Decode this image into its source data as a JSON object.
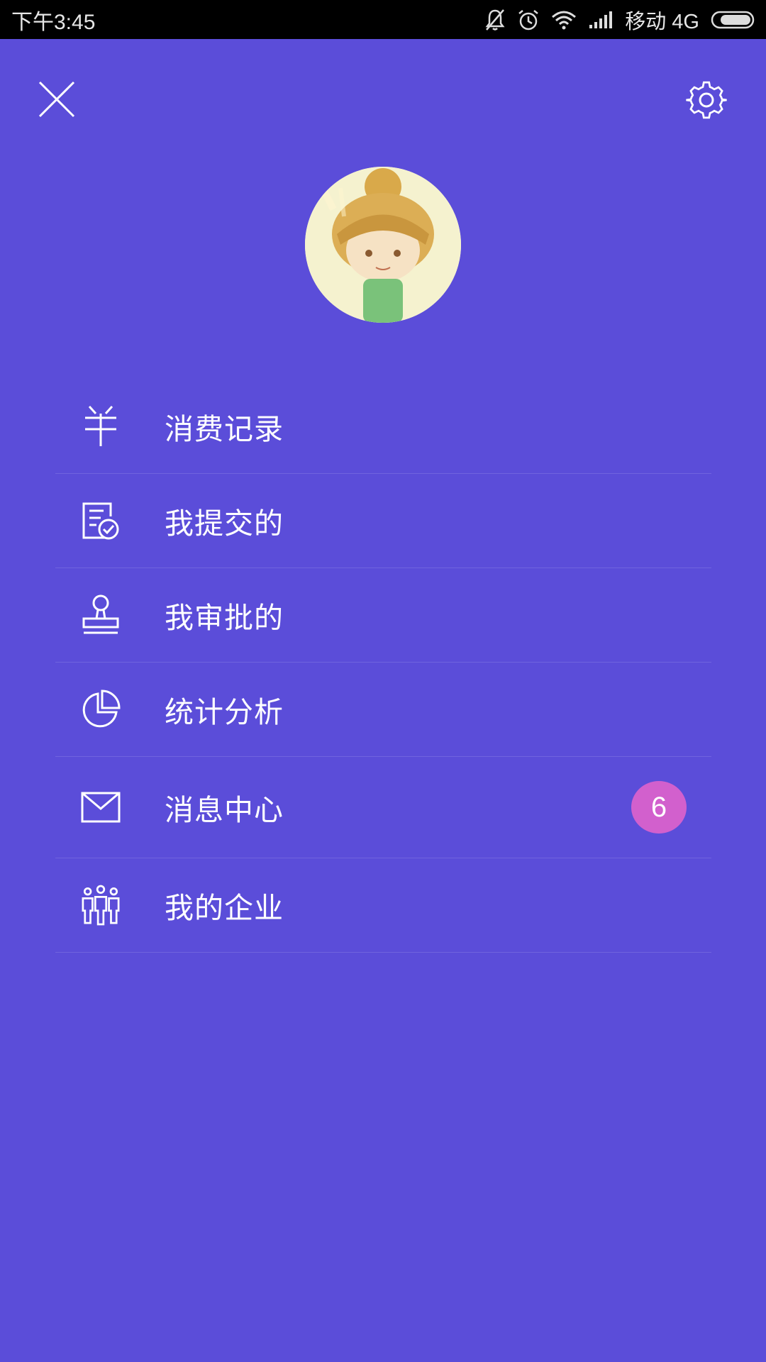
{
  "status_bar": {
    "time": "下午3:45",
    "carrier": "移动 4G"
  },
  "header": {
    "close_icon": "close-icon",
    "settings_icon": "gear-icon"
  },
  "profile": {
    "avatar": "avatar-image"
  },
  "menu": {
    "items": [
      {
        "label": "消费记录",
        "icon": "yuan-icon"
      },
      {
        "label": "我提交的",
        "icon": "document-check-icon"
      },
      {
        "label": "我审批的",
        "icon": "stamp-icon"
      },
      {
        "label": "统计分析",
        "icon": "pie-chart-icon"
      },
      {
        "label": "消息中心",
        "icon": "mail-icon",
        "badge": "6"
      },
      {
        "label": "我的企业",
        "icon": "team-icon"
      }
    ]
  },
  "colors": {
    "background": "#5b4dd9",
    "badge": "#d260cd",
    "status_bar": "#000000"
  }
}
